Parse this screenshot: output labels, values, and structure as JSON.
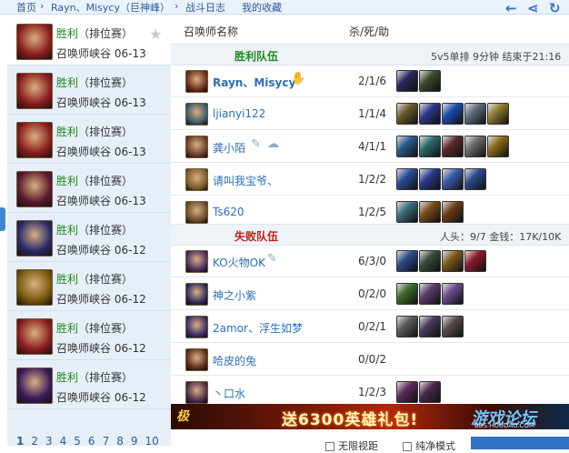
{
  "topnav": {
    "home": "首页",
    "sep1": "›",
    "player": "Rayn、Misycy（巨神峰）",
    "sep2": "›",
    "section": "战斗日志",
    "favorites": "我的收藏",
    "icons": [
      "arrow-left-icon",
      "share-icon",
      "refresh-icon"
    ]
  },
  "sidebar": {
    "items": [
      {
        "result": "胜利",
        "type": "（排位赛）",
        "map": "召唤师峡谷",
        "date": "06-13",
        "color": "#8b1d1d"
      },
      {
        "result": "胜利",
        "type": "（排位赛）",
        "map": "召唤师峡谷",
        "date": "06-13",
        "color": "#8b1d1d"
      },
      {
        "result": "胜利",
        "type": "（排位赛）",
        "map": "召唤师峡谷",
        "date": "06-13",
        "color": "#8b1d1d"
      },
      {
        "result": "胜利",
        "type": "（排位赛）",
        "map": "召唤师峡谷",
        "date": "06-13",
        "color": "#5a1a2e"
      },
      {
        "result": "胜利",
        "type": "（排位赛）",
        "map": "召唤师峡谷",
        "date": "06-12",
        "color": "#2a2a6a"
      },
      {
        "result": "胜利",
        "type": "（排位赛）",
        "map": "召唤师峡谷",
        "date": "06-12",
        "color": "#7a5a10"
      },
      {
        "result": "胜利",
        "type": "（排位赛）",
        "map": "召唤师峡谷",
        "date": "06-12",
        "color": "#8b1d1d"
      },
      {
        "result": "胜利",
        "type": "（排位赛）",
        "map": "召唤师峡谷",
        "date": "06-12",
        "color": "#3a1a5a"
      }
    ],
    "pages": [
      "1",
      "2",
      "3",
      "4",
      "5",
      "6",
      "7",
      "8",
      "9",
      "10"
    ]
  },
  "main": {
    "header_name": "召唤师名称",
    "header_kda": "杀/死/助",
    "win_team": {
      "title": "胜利队伍",
      "info": "5v5单排  9分钟  结束于21:16",
      "players": [
        {
          "name": "Rayn、Misycy",
          "kda": "2/1/6",
          "champ": "#6a2a1a",
          "items": [
            "#2a2a5a",
            "#3a4a2a"
          ]
        },
        {
          "name": "ljianyi122",
          "kda": "1/1/4",
          "champ": "#3a5a6a",
          "items": [
            "#6a5a2a",
            "#2a3a8a",
            "#1a4aaa",
            "#5a6a7a",
            "#8a7a2a"
          ]
        },
        {
          "name": "龚小陌",
          "kda": "4/1/1",
          "champ": "#6a3a2a",
          "items": [
            "#2a5a8a",
            "#2a6a6a",
            "#5a2a2a",
            "#6a6a6a",
            "#8a6a1a"
          ]
        },
        {
          "name": "请叫我宝爷、",
          "kda": "1/2/2",
          "champ": "#7a5a2a",
          "items": [
            "#2a4a9a",
            "#2a3a8a",
            "#3a5aaa",
            "#2a4a8a"
          ]
        },
        {
          "name": "Ts620",
          "kda": "1/2/5",
          "champ": "#6a4a2a",
          "items": [
            "#3a6a7a",
            "#7a4a1a",
            "#6a3a1a"
          ]
        }
      ]
    },
    "lose_team": {
      "title": "失败队伍",
      "info": "人头：9/7  金钱：17K/10K",
      "players": [
        {
          "name": "KO火物OK",
          "kda": "6/3/0",
          "champ": "#4a2a5a",
          "items": [
            "#2a4a8a",
            "#3a4a3a",
            "#7a5a1a",
            "#8a1a2a"
          ]
        },
        {
          "name": "神之小紫",
          "kda": "0/2/0",
          "champ": "#2a2a5a",
          "items": [
            "#3a6a2a",
            "#5a3a6a",
            "#6a4a8a"
          ]
        },
        {
          "name": "2amor、浮生如梦",
          "kda": "0/2/1",
          "champ": "#3a2a6a",
          "items": [
            "#5a5a5a",
            "#4a3a5a",
            "#5a4a4a"
          ]
        },
        {
          "name": "哈皮的兔",
          "kda": "0/0/2",
          "champ": "#5a2a1a",
          "items": []
        },
        {
          "name": "丶口水",
          "kda": "1/2/3",
          "champ": "#4a2a4a",
          "items": [
            "#5a2a5a",
            "#4a2a4a"
          ]
        }
      ]
    },
    "banner": {
      "logo": "极",
      "text": "送6300英雄礼包!",
      "watermark": "游戏论坛",
      "watermark_sub": "BBS.HOUDAO.COM"
    },
    "bottom": {
      "option1": "无限视距",
      "option2": "纯净模式"
    }
  }
}
